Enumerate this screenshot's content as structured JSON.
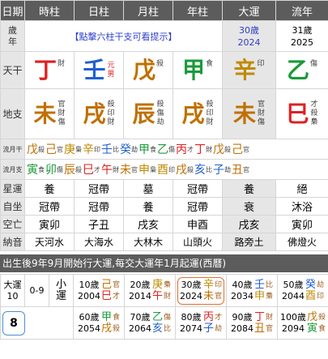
{
  "header": [
    "日期",
    "時柱",
    "日柱",
    "月柱",
    "年柱",
    "大運",
    "流年"
  ],
  "age_row": {
    "label": "歲\n年",
    "hint": "【點擊六柱干支可看提示】",
    "dayun_age": "30歲",
    "dayun_year": "2024",
    "liunian_age": "31歲",
    "liunian_year": "2025"
  },
  "tiangan": {
    "label": "天干",
    "cols": [
      {
        "char": "丁",
        "color": "#e02020",
        "god": "財"
      },
      {
        "char": "壬",
        "color": "#2060d0",
        "god_top": "元",
        "god_bot": "男",
        "god_color": "#e02020"
      },
      {
        "char": "戊",
        "color": "#c07000",
        "god": "殺"
      },
      {
        "char": "甲",
        "color": "#1a9a3a",
        "god": "食"
      },
      {
        "char": "辛",
        "color": "#c08a00",
        "god": "印"
      },
      {
        "char": "乙",
        "color": "#1a9a3a",
        "god": "傷"
      }
    ]
  },
  "dizhi": {
    "label": "地支",
    "cols": [
      {
        "char": "未",
        "color": "#c07000",
        "gods": [
          "官",
          "財",
          "傷"
        ]
      },
      {
        "char": "戌",
        "color": "#c07000",
        "gods": [
          "殺",
          "印",
          "財"
        ]
      },
      {
        "char": "辰",
        "color": "#c07000",
        "gods": [
          "殺",
          "傷",
          "劫"
        ]
      },
      {
        "char": "戌",
        "color": "#c07000",
        "gods": [
          "殺",
          "印",
          "財"
        ]
      },
      {
        "char": "未",
        "color": "#c07000",
        "gods": [
          "官",
          "財",
          "傷"
        ]
      },
      {
        "char": "巳",
        "color": "#e02020",
        "gods": [
          "才",
          "殺",
          "梟"
        ]
      }
    ]
  },
  "liuyue": {
    "label": "流月干",
    "items": [
      [
        "戊",
        "殺",
        "#c07000"
      ],
      [
        "己",
        "官",
        "#c07000"
      ],
      [
        "庚",
        "梟",
        "#c08a00"
      ],
      [
        "辛",
        "印",
        "#c08a00"
      ],
      [
        "壬",
        "比",
        "#2060d0"
      ],
      [
        "癸",
        "劫",
        "#2060d0"
      ],
      [
        "甲",
        "食",
        "#1a9a3a"
      ],
      [
        "乙",
        "傷",
        "#1a9a3a"
      ],
      [
        "丙",
        "才",
        "#e02020"
      ],
      [
        "丁",
        "財",
        "#e02020"
      ],
      [
        "戊",
        "殺",
        "#c07000"
      ],
      [
        "己",
        "官",
        "#c07000"
      ]
    ]
  },
  "liuyuezhi": {
    "label": "流月支",
    "items": [
      [
        "寅",
        "食",
        "#1a9a3a"
      ],
      [
        "卯",
        "傷",
        "#1a9a3a"
      ],
      [
        "辰",
        "殺",
        "#c07000"
      ],
      [
        "巳",
        "才",
        "#e02020"
      ],
      [
        "午",
        "財",
        "#e02020"
      ],
      [
        "未",
        "官",
        "#c07000"
      ],
      [
        "申",
        "梟",
        "#c08a00"
      ],
      [
        "酉",
        "印",
        "#c08a00"
      ],
      [
        "戌",
        "殺",
        "#c07000"
      ],
      [
        "亥",
        "比",
        "#2060d0"
      ],
      [
        "子",
        "劫",
        "#2060d0"
      ],
      [
        "丑",
        "官",
        "#c07000"
      ]
    ]
  },
  "xingyun": {
    "label": "星運",
    "cols": [
      "養",
      "冠帶",
      "墓",
      "冠帶",
      "養",
      "絕"
    ]
  },
  "zizuo": {
    "label": "自坐",
    "cols": [
      "冠帶",
      "冠帶",
      "養",
      "冠帶",
      "衰",
      "沐浴"
    ]
  },
  "kongwang": {
    "label": "空亡",
    "cols": [
      "寅卯",
      "子丑",
      "戌亥",
      "申酉",
      "戌亥",
      "寅卯"
    ]
  },
  "nayin": {
    "label": "納音",
    "cols": [
      "天河水",
      "大海水",
      "大林木",
      "山頭火",
      "路旁土",
      "佛燈火"
    ]
  },
  "dayun_info": "出生後9年9月開始行大運,每交大運年1月起運(西曆)",
  "dayun_table": {
    "label_top": "大運",
    "label_num": "10",
    "range": "0-9",
    "xiao_top": "小",
    "xiao_bot": "運",
    "entries": [
      {
        "age": "10歲",
        "year": "2004",
        "g": "己",
        "z": "巳",
        "g_color": "#c07000",
        "z_color": "#e02020",
        "gg": "官",
        "zg": "才"
      },
      {
        "age": "20歲",
        "year": "2014",
        "g": "庚",
        "z": "午",
        "g_color": "#c08a00",
        "z_color": "#e02020",
        "gg": "梟",
        "zg": "財"
      },
      {
        "age": "30歲",
        "year": "2024",
        "g": "辛",
        "z": "未",
        "g_color": "#c08a00",
        "z_color": "#c07000",
        "gg": "印",
        "zg": "官"
      },
      {
        "age": "40歲",
        "year": "2034",
        "g": "壬",
        "z": "申",
        "g_color": "#2060d0",
        "z_color": "#c08a00",
        "gg": "比",
        "zg": "梟"
      },
      {
        "age": "50歲",
        "year": "2044",
        "g": "癸",
        "z": "酉",
        "g_color": "#2060d0",
        "z_color": "#c08a00",
        "gg": "劫",
        "zg": "印"
      },
      {
        "age": "60歲",
        "year": "2054",
        "g": "甲",
        "z": "戌",
        "g_color": "#1a9a3a",
        "z_color": "#c07000",
        "gg": "食",
        "zg": "殺"
      },
      {
        "age": "70歲",
        "year": "2064",
        "g": "乙",
        "z": "亥",
        "g_color": "#1a9a3a",
        "z_color": "#2060d0",
        "gg": "傷",
        "zg": "比"
      },
      {
        "age": "80歲",
        "year": "2074",
        "g": "丙",
        "z": "子",
        "g_color": "#e02020",
        "z_color": "#2060d0",
        "gg": "才",
        "zg": "劫"
      },
      {
        "age": "90歲",
        "year": "2084",
        "g": "丁",
        "z": "丑",
        "g_color": "#e02020",
        "z_color": "#c07000",
        "gg": "財",
        "zg": "官"
      },
      {
        "age": "100歲",
        "year": "2094",
        "g": "戊",
        "z": "寅",
        "g_color": "#c07000",
        "z_color": "#1a9a3a",
        "gg": "殺",
        "zg": "食"
      }
    ],
    "xiao_value": "8"
  }
}
